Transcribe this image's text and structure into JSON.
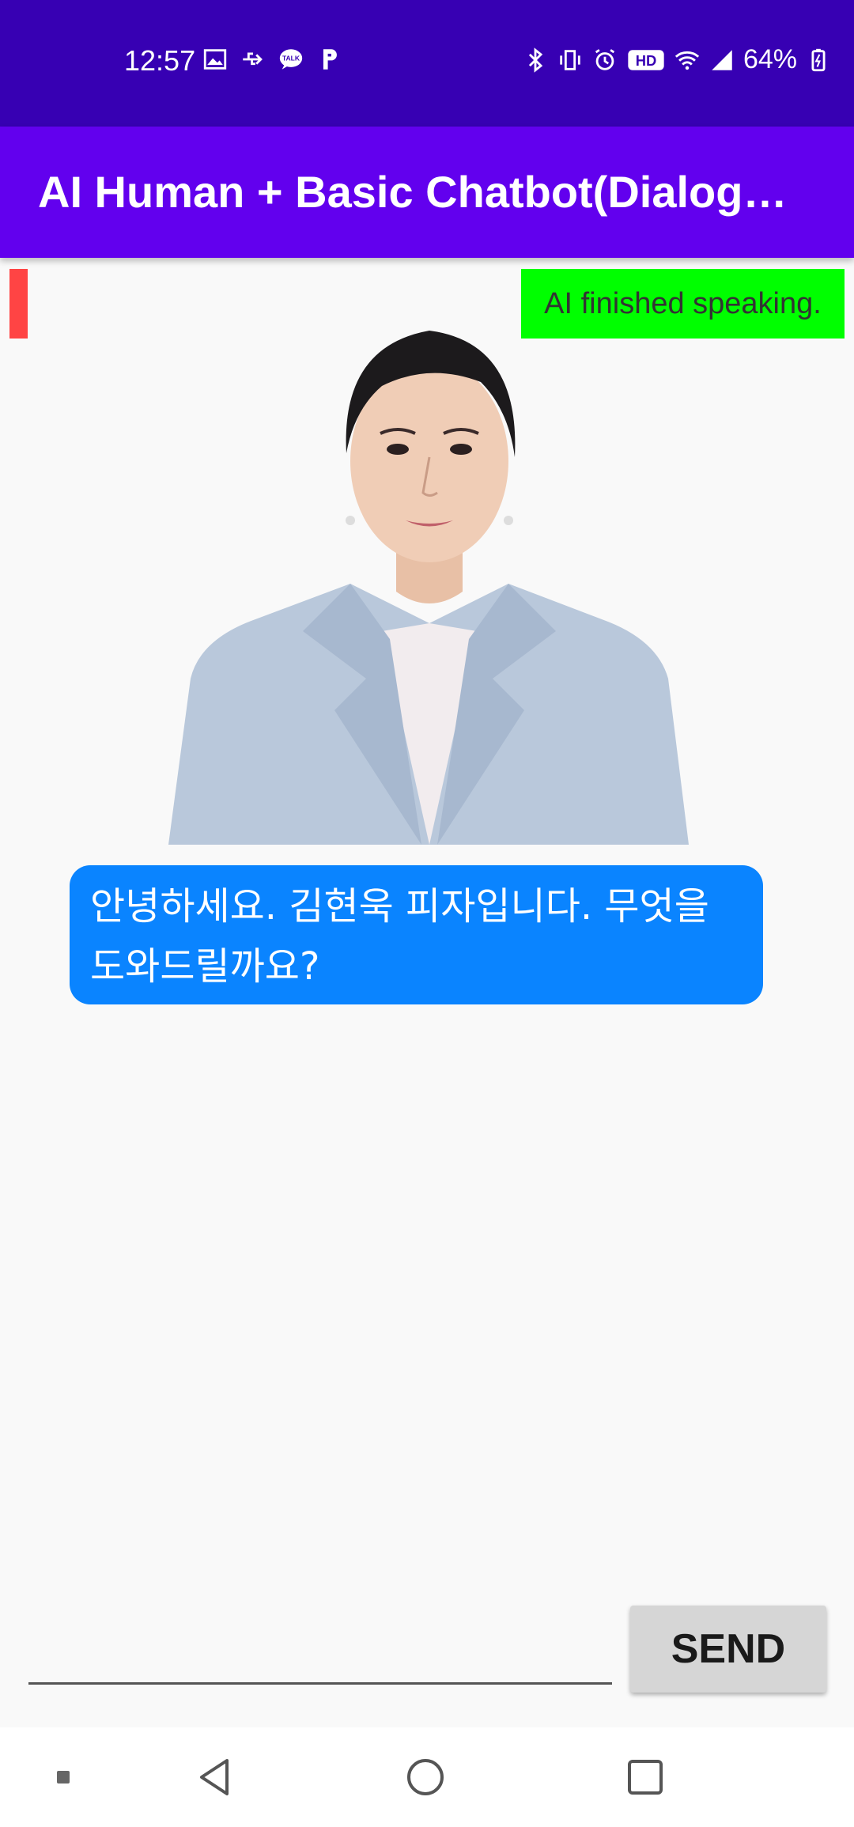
{
  "status_bar": {
    "time": "12:57",
    "battery": "64%",
    "left_icons": [
      "image-icon",
      "usb-icon",
      "talk-icon",
      "p-icon"
    ],
    "right_icons": [
      "bluetooth-icon",
      "vibrate-icon",
      "alarm-icon",
      "hd-icon",
      "wifi-icon",
      "signal-icon",
      "battery-icon"
    ]
  },
  "app_bar": {
    "title": "AI Human + Basic Chatbot(DialogFlow)"
  },
  "ai_status": {
    "text": "AI finished speaking.",
    "status_color": "#00ff00",
    "indicator_color": "#ff4444"
  },
  "chat": {
    "message": "안녕하세요. 김현욱 피자입니다. 무엇을 도와드릴까요?",
    "bubble_color": "#0a84ff"
  },
  "input": {
    "value": "",
    "placeholder": ""
  },
  "send_button": {
    "label": "SEND"
  },
  "colors": {
    "status_bar": "#3700b3",
    "app_bar": "#6200ee"
  }
}
